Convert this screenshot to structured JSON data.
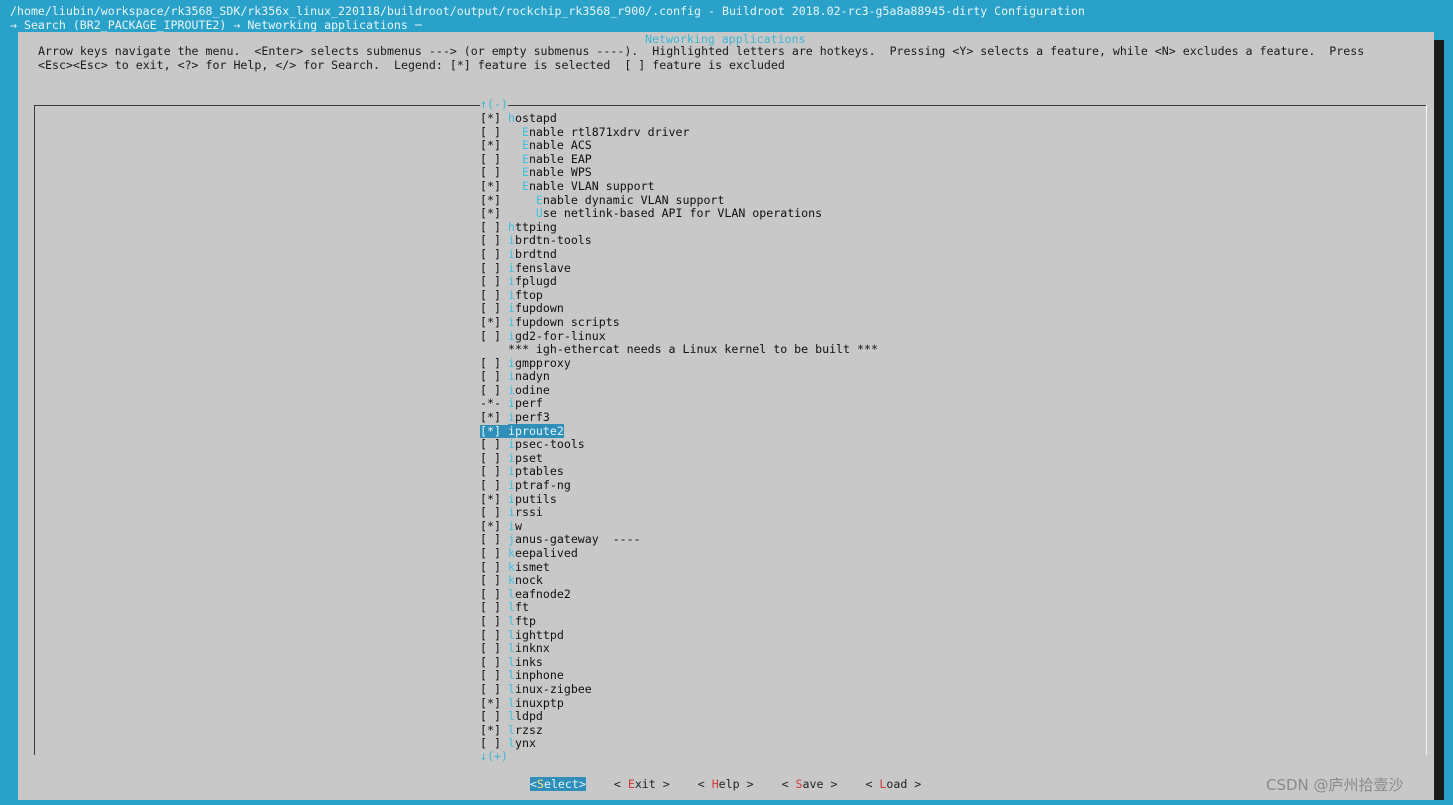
{
  "window": {
    "title": "/home/liubin/workspace/rk3568_SDK/rk356x_linux_220118/buildroot/output/rockchip_rk3568_r900/.config - Buildroot 2018.02-rc3-g5a8a88945-dirty Configuration",
    "breadcrumb": "→ Search (BR2_PACKAGE_IPROUTE2) → Networking applications ─"
  },
  "help": {
    "line1": "Arrow keys navigate the menu.  <Enter> selects submenus ---> (or empty submenus ----).  Highlighted letters are hotkeys.  Pressing <Y> selects a feature, while <N> excludes a feature.  Press",
    "line2": "<Esc><Esc> to exit, <?> for Help, </> for Search.  Legend: [*] feature is selected  [ ] feature is excluded"
  },
  "menu": {
    "title": "Networking applications",
    "scroll_up": "↑(-)",
    "scroll_down": "↓(+)",
    "items": [
      {
        "mark": "[*]",
        "indent": "",
        "hotkey": "h",
        "rest": "ostapd",
        "name": "hostapd"
      },
      {
        "mark": "[ ]",
        "indent": "  ",
        "hotkey": "E",
        "rest": "nable rtl871xdrv driver",
        "name": "enable-rtl871xdrv"
      },
      {
        "mark": "[*]",
        "indent": "  ",
        "hotkey": "E",
        "rest": "nable ACS",
        "name": "enable-acs"
      },
      {
        "mark": "[ ]",
        "indent": "  ",
        "hotkey": "E",
        "rest": "nable EAP",
        "name": "enable-eap"
      },
      {
        "mark": "[ ]",
        "indent": "  ",
        "hotkey": "E",
        "rest": "nable WPS",
        "name": "enable-wps"
      },
      {
        "mark": "[*]",
        "indent": "  ",
        "hotkey": "E",
        "rest": "nable VLAN support",
        "name": "enable-vlan"
      },
      {
        "mark": "[*]",
        "indent": "    ",
        "hotkey": "E",
        "rest": "nable dynamic VLAN support",
        "name": "enable-dynamic-vlan"
      },
      {
        "mark": "[*]",
        "indent": "    ",
        "hotkey": "U",
        "rest": "se netlink-based API for VLAN operations",
        "name": "use-netlink-vlan"
      },
      {
        "mark": "[ ]",
        "indent": "",
        "hotkey": "h",
        "rest": "ttping",
        "name": "httping"
      },
      {
        "mark": "[ ]",
        "indent": "",
        "hotkey": "i",
        "rest": "brdtn-tools",
        "name": "ibrdtn-tools"
      },
      {
        "mark": "[ ]",
        "indent": "",
        "hotkey": "i",
        "rest": "brdtnd",
        "name": "ibrdtnd"
      },
      {
        "mark": "[ ]",
        "indent": "",
        "hotkey": "i",
        "rest": "fenslave",
        "name": "ifenslave"
      },
      {
        "mark": "[ ]",
        "indent": "",
        "hotkey": "i",
        "rest": "fplugd",
        "name": "ifplugd"
      },
      {
        "mark": "[ ]",
        "indent": "",
        "hotkey": "i",
        "rest": "ftop",
        "name": "iftop"
      },
      {
        "mark": "[ ]",
        "indent": "",
        "hotkey": "i",
        "rest": "fupdown",
        "name": "ifupdown"
      },
      {
        "mark": "[*]",
        "indent": "",
        "hotkey": "i",
        "rest": "fupdown scripts",
        "name": "ifupdown-scripts"
      },
      {
        "mark": "[ ]",
        "indent": "",
        "hotkey": "i",
        "rest": "gd2-for-linux",
        "name": "igd2-for-linux"
      },
      {
        "mark": "   ",
        "indent": "",
        "hotkey": "",
        "rest": "*** igh-ethercat needs a Linux kernel to be built ***",
        "name": "igh-ethercat-comment"
      },
      {
        "mark": "[ ]",
        "indent": "",
        "hotkey": "i",
        "rest": "gmpproxy",
        "name": "igmpproxy"
      },
      {
        "mark": "[ ]",
        "indent": "",
        "hotkey": "i",
        "rest": "nadyn",
        "name": "inadyn"
      },
      {
        "mark": "[ ]",
        "indent": "",
        "hotkey": "i",
        "rest": "odine",
        "name": "iodine"
      },
      {
        "mark": "-*-",
        "indent": "",
        "hotkey": "i",
        "rest": "perf",
        "name": "iperf"
      },
      {
        "mark": "[*]",
        "indent": "",
        "hotkey": "i",
        "rest": "perf3",
        "name": "iperf3"
      },
      {
        "mark": "[*]",
        "indent": "",
        "hotkey": "i",
        "rest": "proute2",
        "name": "iproute2",
        "selected": true
      },
      {
        "mark": "[ ]",
        "indent": "",
        "hotkey": "i",
        "rest": "psec-tools",
        "name": "ipsec-tools"
      },
      {
        "mark": "[ ]",
        "indent": "",
        "hotkey": "i",
        "rest": "pset",
        "name": "ipset"
      },
      {
        "mark": "[ ]",
        "indent": "",
        "hotkey": "i",
        "rest": "ptables",
        "name": "iptables"
      },
      {
        "mark": "[ ]",
        "indent": "",
        "hotkey": "i",
        "rest": "ptraf-ng",
        "name": "iptraf-ng"
      },
      {
        "mark": "[*]",
        "indent": "",
        "hotkey": "i",
        "rest": "putils",
        "name": "iputils"
      },
      {
        "mark": "[ ]",
        "indent": "",
        "hotkey": "i",
        "rest": "rssi",
        "name": "irssi"
      },
      {
        "mark": "[*]",
        "indent": "",
        "hotkey": "i",
        "rest": "w",
        "name": "iw"
      },
      {
        "mark": "[ ]",
        "indent": "",
        "hotkey": "j",
        "rest": "anus-gateway  ----",
        "name": "janus-gateway"
      },
      {
        "mark": "[ ]",
        "indent": "",
        "hotkey": "k",
        "rest": "eepalived",
        "name": "keepalived"
      },
      {
        "mark": "[ ]",
        "indent": "",
        "hotkey": "k",
        "rest": "ismet",
        "name": "kismet"
      },
      {
        "mark": "[ ]",
        "indent": "",
        "hotkey": "k",
        "rest": "nock",
        "name": "knock"
      },
      {
        "mark": "[ ]",
        "indent": "",
        "hotkey": "l",
        "rest": "eafnode2",
        "name": "leafnode2"
      },
      {
        "mark": "[ ]",
        "indent": "",
        "hotkey": "l",
        "rest": "ft",
        "name": "lft"
      },
      {
        "mark": "[ ]",
        "indent": "",
        "hotkey": "l",
        "rest": "ftp",
        "name": "lftp"
      },
      {
        "mark": "[ ]",
        "indent": "",
        "hotkey": "l",
        "rest": "ighttpd",
        "name": "lighttpd"
      },
      {
        "mark": "[ ]",
        "indent": "",
        "hotkey": "l",
        "rest": "inknx",
        "name": "linknx"
      },
      {
        "mark": "[ ]",
        "indent": "",
        "hotkey": "l",
        "rest": "inks",
        "name": "links"
      },
      {
        "mark": "[ ]",
        "indent": "",
        "hotkey": "l",
        "rest": "inphone",
        "name": "linphone"
      },
      {
        "mark": "[ ]",
        "indent": "",
        "hotkey": "l",
        "rest": "inux-zigbee",
        "name": "linux-zigbee"
      },
      {
        "mark": "[*]",
        "indent": "",
        "hotkey": "l",
        "rest": "inuxptp",
        "name": "linuxptp"
      },
      {
        "mark": "[ ]",
        "indent": "",
        "hotkey": "l",
        "rest": "ldpd",
        "name": "lldpd"
      },
      {
        "mark": "[*]",
        "indent": "",
        "hotkey": "l",
        "rest": "rzsz",
        "name": "lrzsz"
      },
      {
        "mark": "[ ]",
        "indent": "",
        "hotkey": "l",
        "rest": "ynx",
        "name": "lynx"
      }
    ]
  },
  "buttons": [
    {
      "pre": "<",
      "hotkey": "S",
      "rest": "elect>",
      "name": "select-button",
      "active": true
    },
    {
      "pre": "< ",
      "hotkey": "E",
      "rest": "xit >",
      "name": "exit-button"
    },
    {
      "pre": "< ",
      "hotkey": "H",
      "rest": "elp >",
      "name": "help-button"
    },
    {
      "pre": "< ",
      "hotkey": "S",
      "rest": "ave >",
      "name": "save-button"
    },
    {
      "pre": "< ",
      "hotkey": "L",
      "rest": "oad >",
      "name": "load-button"
    }
  ],
  "watermark": "CSDN @庐州拾壹沙"
}
